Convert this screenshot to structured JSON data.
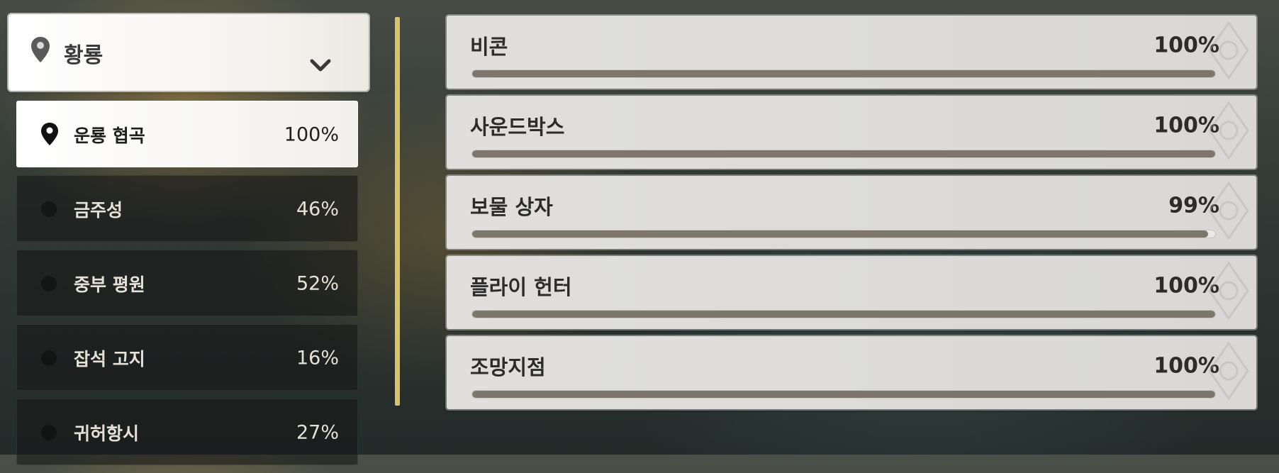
{
  "region": {
    "selected": "황룡",
    "icon": "map-pin-icon",
    "dropdown_icon": "chevron-down-icon"
  },
  "areas": [
    {
      "name": "운룡 협곡",
      "pct": "100%",
      "active": true
    },
    {
      "name": "금주성",
      "pct": "46%",
      "active": false
    },
    {
      "name": "중부 평원",
      "pct": "52%",
      "active": false
    },
    {
      "name": "잡석 고지",
      "pct": "16%",
      "active": false
    },
    {
      "name": "귀허항시",
      "pct": "27%",
      "active": false
    }
  ],
  "categories": [
    {
      "name": "비콘",
      "pct": "100%",
      "progress": 1.0
    },
    {
      "name": "사운드박스",
      "pct": "100%",
      "progress": 1.0
    },
    {
      "name": "보물 상자",
      "pct": "99%",
      "progress": 0.99
    },
    {
      "name": "플라이 헌터",
      "pct": "100%",
      "progress": 1.0
    },
    {
      "name": "조망지점",
      "pct": "100%",
      "progress": 1.0
    }
  ],
  "colors": {
    "accent_divider": "#d8c36a",
    "progress_fill": "#7d776b",
    "card_bg": "#dcdbd9"
  }
}
